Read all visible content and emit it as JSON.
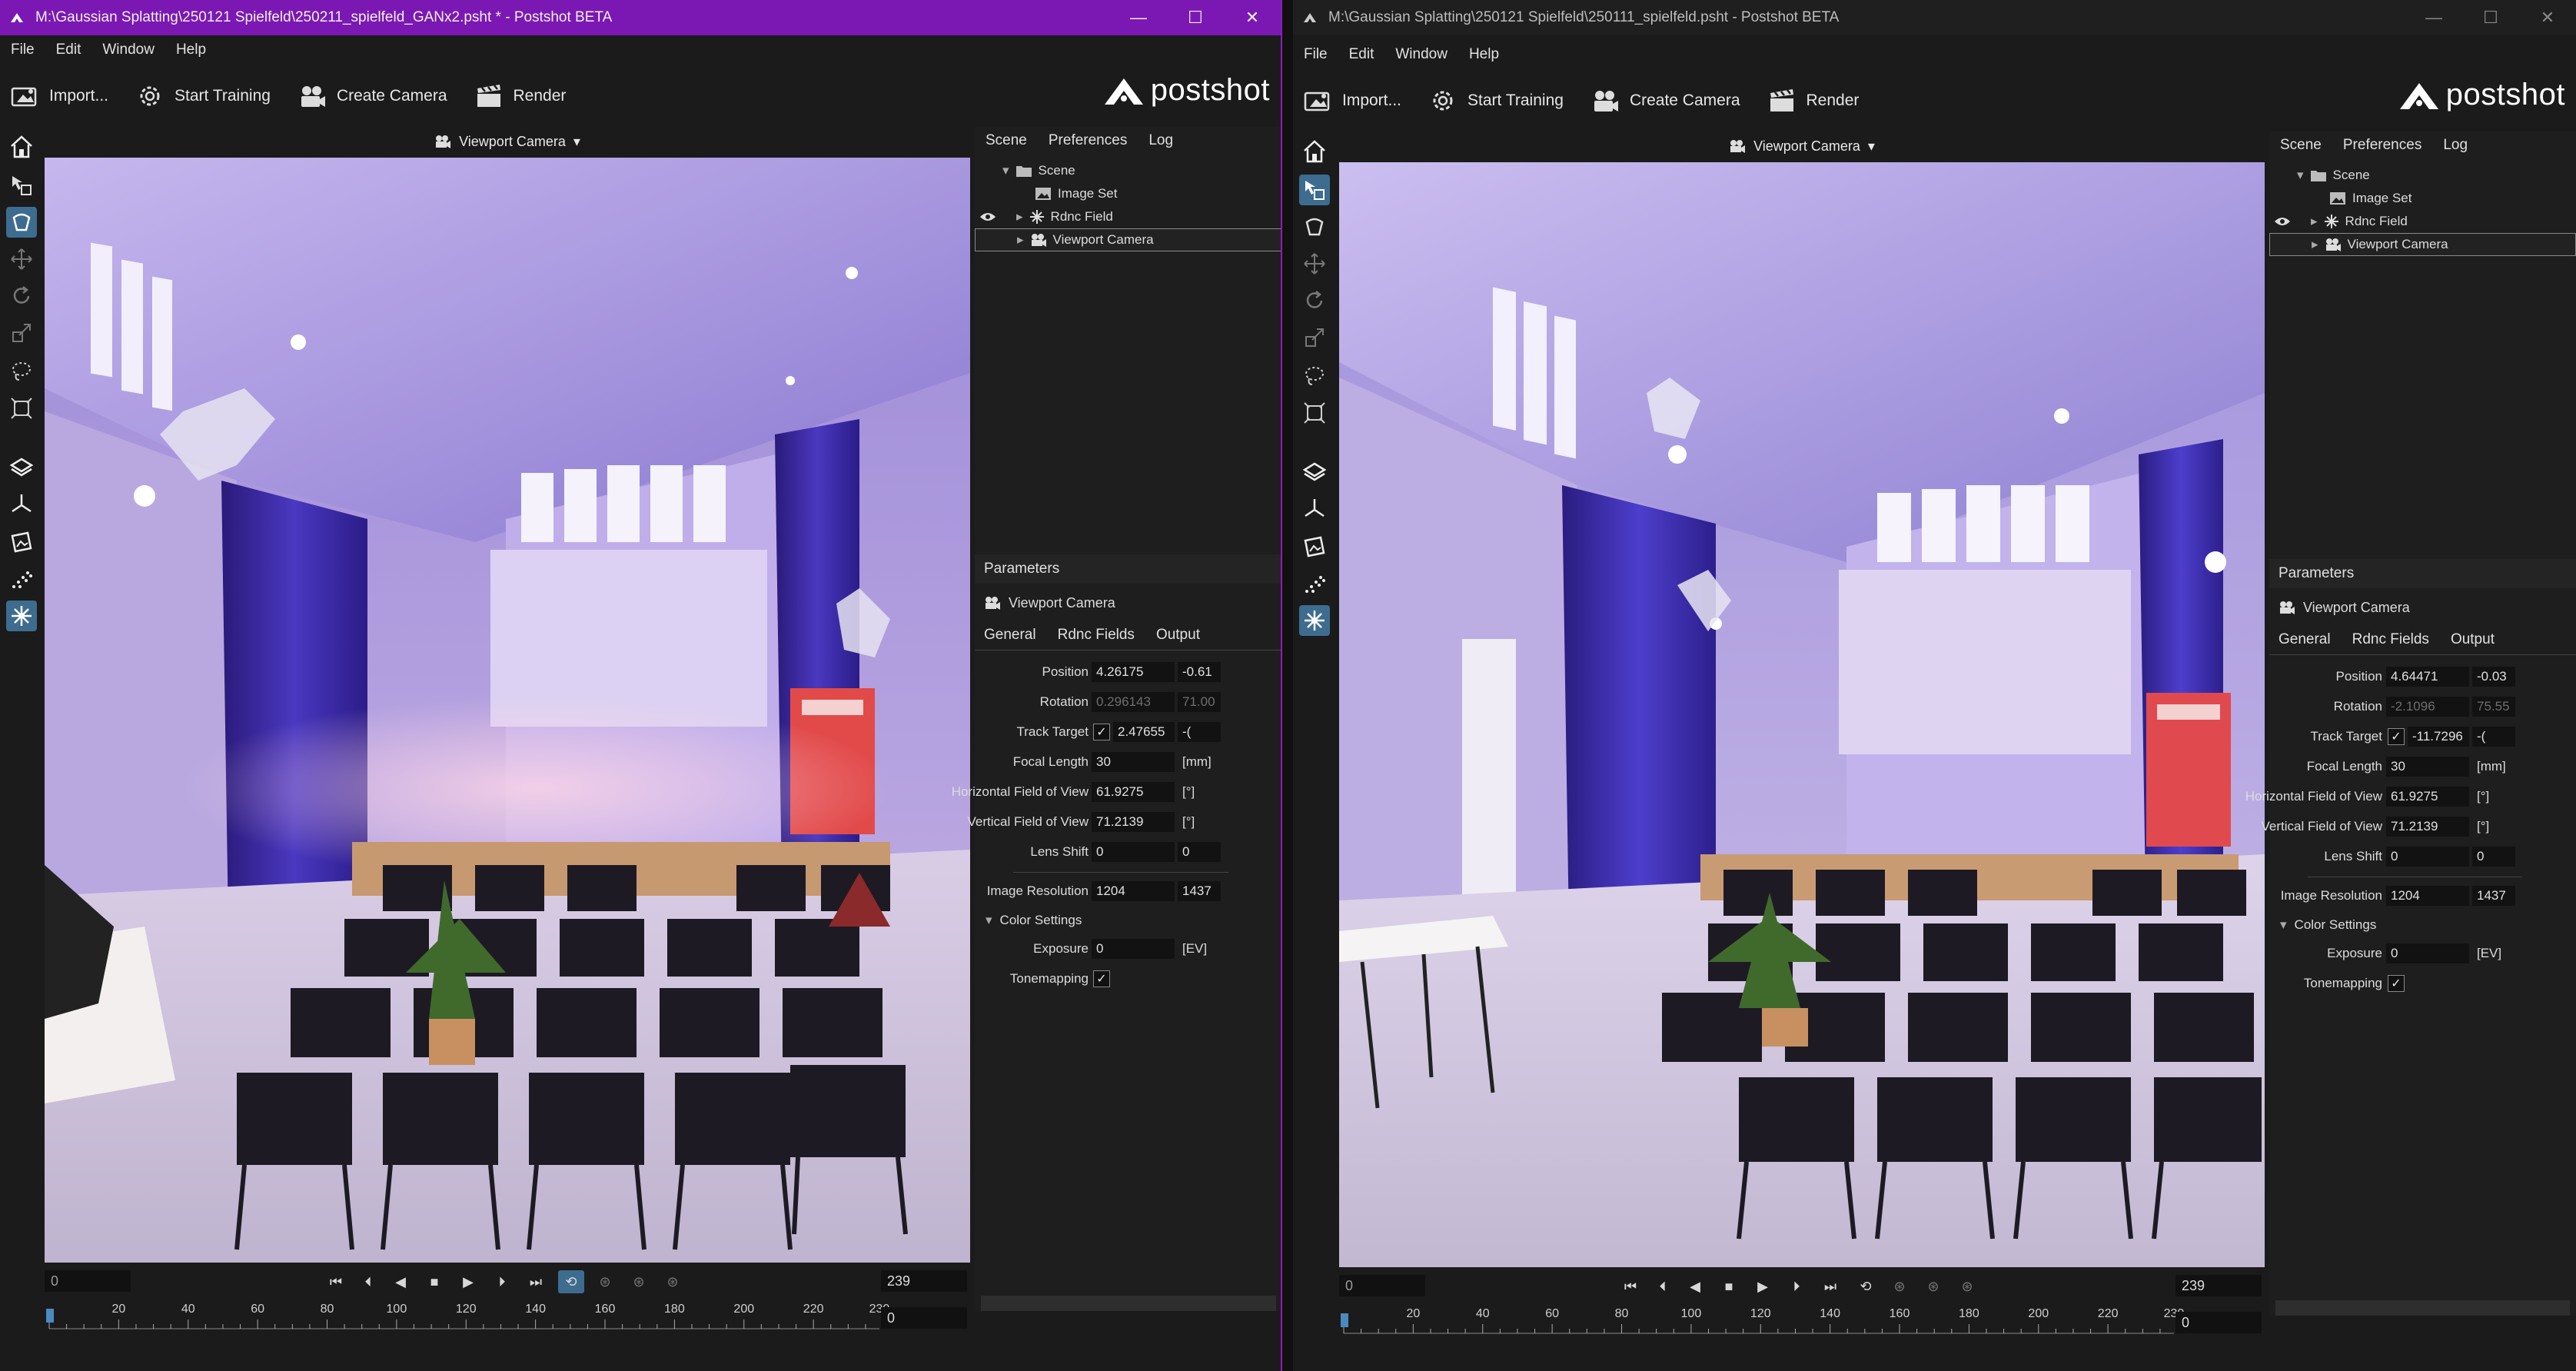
{
  "left_window": {
    "title": "M:\\Gaussian Splatting\\250121 Spielfeld\\250211_spielfeld_GANx2.psht * - Postshot BETA",
    "position": [
      "4.26175",
      "-0.61"
    ],
    "rotation": [
      "0.296143",
      "71.00"
    ],
    "track_target": [
      "2.47655",
      "-("
    ],
    "focal_length": "30",
    "hfov": "61.9275",
    "vfov": "71.2139",
    "lens_shift": [
      "0",
      "0"
    ],
    "image_resolution": [
      "1204",
      "1437"
    ],
    "exposure": "0",
    "frame_start": "0",
    "frame_end": "239",
    "frame_current": "0"
  },
  "right_window": {
    "title": "M:\\Gaussian Splatting\\250121 Spielfeld\\250111_spielfeld.psht - Postshot BETA",
    "position": [
      "4.64471",
      "-0.03"
    ],
    "rotation": [
      "-2.1096",
      "75.55"
    ],
    "track_target": [
      "-11.7296",
      "-("
    ],
    "focal_length": "30",
    "hfov": "61.9275",
    "vfov": "71.2139",
    "lens_shift": [
      "0",
      "0"
    ],
    "image_resolution": [
      "1204",
      "1437"
    ],
    "exposure": "0",
    "frame_start": "0",
    "frame_end": "239",
    "frame_current": "0"
  },
  "menu": {
    "file": "File",
    "edit": "Edit",
    "window": "Window",
    "help": "Help"
  },
  "toolbar": {
    "import": "Import...",
    "start_training": "Start Training",
    "create_camera": "Create Camera",
    "render": "Render"
  },
  "logo": "postshot",
  "viewport": {
    "camera_label": "Viewport Camera",
    "dropdown_arrow": "▾"
  },
  "panel_tabs": {
    "scene": "Scene",
    "preferences": "Preferences",
    "log": "Log"
  },
  "tree": {
    "scene": "Scene",
    "image_set": "Image Set",
    "rdnc_field": "Rdnc Field",
    "viewport_camera": "Viewport Camera"
  },
  "params": {
    "heading": "Parameters",
    "object": "Viewport Camera",
    "tab_general": "General",
    "tab_rdnc": "Rdnc Fields",
    "tab_output": "Output",
    "label_position": "Position",
    "label_rotation": "Rotation",
    "label_track_target": "Track Target",
    "label_focal_length": "Focal Length",
    "label_hfov": "Horizontal Field of View",
    "label_vfov": "Vertical Field of View",
    "label_lens_shift": "Lens Shift",
    "label_image_resolution": "Image Resolution",
    "label_color_settings": "Color Settings",
    "label_exposure": "Exposure",
    "label_tonemapping": "Tonemapping",
    "unit_mm": "[mm]",
    "unit_deg": "[°]",
    "unit_ev": "[EV]"
  },
  "ruler_ticks": [
    "20",
    "40",
    "60",
    "80",
    "100",
    "120",
    "140",
    "160",
    "180",
    "200",
    "220",
    "239"
  ],
  "colors": {
    "left_titlebar": "#7b18b3",
    "accent": "#3d6c8f",
    "panel_bg": "#1e1e1e"
  },
  "icons": {
    "window_minimize": "—",
    "window_maximize": "☐",
    "window_close": "✕",
    "check": "✓"
  }
}
